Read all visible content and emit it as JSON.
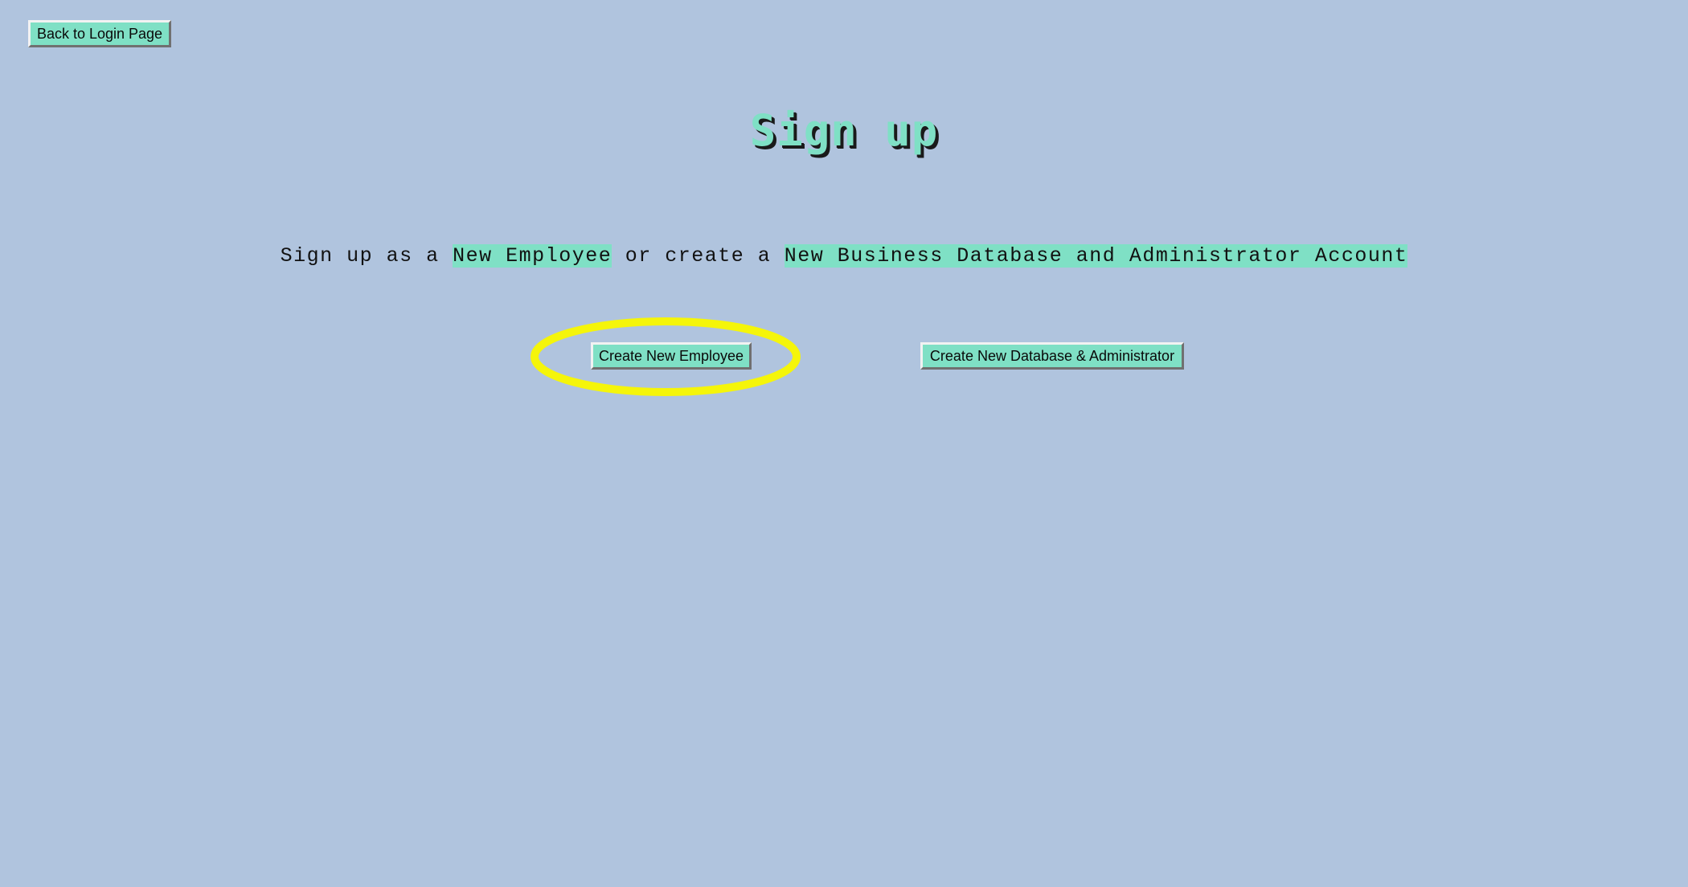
{
  "nav": {
    "back_label": "Back to Login Page"
  },
  "header": {
    "title": "Sign up"
  },
  "intro": {
    "part1": "Sign up as a ",
    "highlight1": "New Employee",
    "part2": " or create a ",
    "highlight2": "New Business Database and Administrator Account"
  },
  "actions": {
    "new_employee_label": "Create New Employee",
    "new_database_label": "Create New Database & Administrator"
  },
  "annotation": {
    "highlight_color": "#f5f50a",
    "target": "Create New Employee"
  },
  "colors": {
    "background": "#b0c4de",
    "accent": "#7fe0c5"
  }
}
